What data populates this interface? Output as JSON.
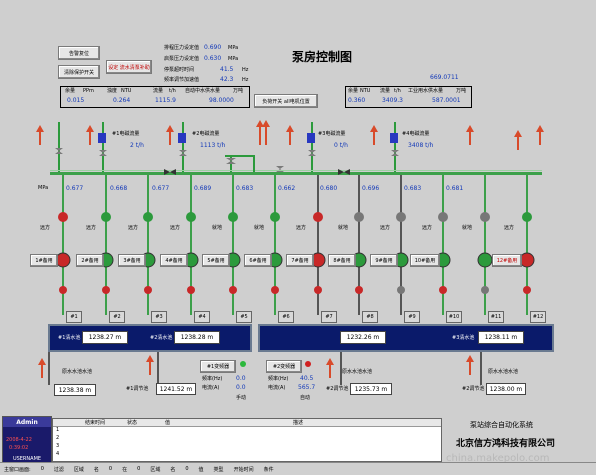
{
  "title": "泵房控制图",
  "buttons": {
    "alarm_reset": "告警复位",
    "pump_protect": "清除保护开关",
    "manual_mode": "设定 流水清泵补助",
    "all_pumps_speed": "负荷开关 all电机位置"
  },
  "top_params": [
    {
      "label": "排程压力设定值",
      "value": "0.690",
      "unit": "MPa"
    },
    {
      "label": "启泵压力设定值",
      "value": "0.630",
      "unit": "MPa"
    },
    {
      "label": "停泵超时时间",
      "value": "41.5",
      "unit": "Hz"
    },
    {
      "label": "频率调节加速值",
      "value": "42.3",
      "unit": "Hz"
    }
  ],
  "left_table": {
    "headers": [
      "余量",
      "PPm",
      "浊度",
      "NTU",
      "流量",
      "t/h",
      "自动中水供水量",
      "万吨"
    ],
    "values": [
      "0.015",
      "0.264",
      "1115.9",
      "98.0000"
    ]
  },
  "right_table": {
    "total": "669.0711",
    "headers": [
      "余量",
      "NTU",
      "流量",
      "t/h",
      "工业用水供水量",
      "万吨"
    ],
    "values": [
      "0.360",
      "3409.3",
      "587.0001"
    ]
  },
  "flow_readings": [
    {
      "label": "#1电磁流量",
      "value": "2 t/h"
    },
    {
      "label": "#2电磁流量",
      "value": "1113 t/h"
    },
    {
      "label": "#3电磁流量",
      "value": "0 t/h"
    },
    {
      "label": "#4电磁流量",
      "value": "3408 t/h"
    }
  ],
  "pressure_unit": "MPa",
  "pressures": [
    "0.677",
    "0.668",
    "0.677",
    "0.689",
    "0.683",
    "0.662",
    "0.680",
    "0.696",
    "0.683",
    "0.681"
  ],
  "pump_labels": [
    "1#备用",
    "2#备用",
    "3#备用",
    "4#备用",
    "5#备用",
    "6#备用",
    "7#备用",
    "8#备用",
    "9#备用",
    "10#备用",
    "11#备用",
    "12#备用"
  ],
  "pump_status_labels": [
    "远方",
    "远方",
    "远方",
    "远方",
    "就地",
    "就地",
    "远方",
    "就地",
    "远方",
    "远方",
    "就地",
    "远方"
  ],
  "pump_numbers": [
    "#1",
    "#2",
    "#3",
    "#4",
    "#5",
    "#6",
    "#7",
    "#8",
    "#9",
    "#10",
    "#11",
    "#12"
  ],
  "tanks": [
    {
      "left_label": "#1清水池",
      "value": "1238.27 m",
      "right_label": "#2清水池",
      "value2": "1238.28 m"
    },
    {
      "left_label": "",
      "value": "1232.26 m",
      "right_label": "#3清水池",
      "value2": "1238.11 m"
    }
  ],
  "lower_left": {
    "label1": "原水水池水池",
    "value1": "1238.38 m",
    "label2": "#1调节池",
    "value2": "1241.52 m"
  },
  "lower_mid": {
    "btn1": "#1变频器",
    "btn2": "#2变频器",
    "freq_label": "频率(Hz)",
    "current_label": "电流(A)",
    "f1": "0.0",
    "i1": "0.0",
    "f2": "40.5",
    "i2": "565.7",
    "mode1": "手动",
    "mode2": "自动"
  },
  "lower_right": {
    "label1": "原水水池水池",
    "value1": "1235.73 m",
    "label2": "#2调节池",
    "value2": "1238.00 m"
  },
  "user_panel": {
    "title": "Admin",
    "date": "2008-4-22",
    "time": "0:39:02",
    "role": "USERNAME"
  },
  "event_table": {
    "headers": [
      "",
      "结束时间",
      "状态",
      "值",
      "描述"
    ],
    "rows": [
      "1",
      "2",
      "3",
      "4"
    ]
  },
  "company": {
    "system": "泵站综合自动化系统",
    "name": "北京信方鸿科技有限公司",
    "watermark": "china.makepolo.com"
  },
  "status_bar": [
    "主窗口画面:",
    "0",
    "过滤",
    "区域",
    "名",
    "0",
    "在",
    "0",
    "区域",
    "名",
    "0",
    "值",
    "类型",
    "开始时间",
    "条件"
  ]
}
